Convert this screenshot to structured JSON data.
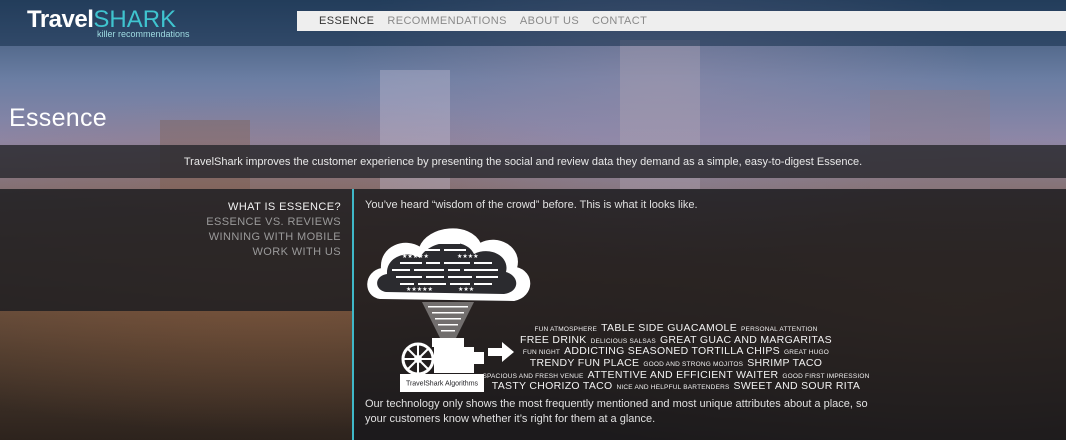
{
  "brand": {
    "name_part1": "Travel",
    "name_part2": "SHARK",
    "tagline": "killer recommendations"
  },
  "nav": {
    "items": [
      {
        "label": "ESSENCE",
        "active": true
      },
      {
        "label": "RECOMMENDATIONS",
        "active": false
      },
      {
        "label": "ABOUT US",
        "active": false
      },
      {
        "label": "CONTACT",
        "active": false
      }
    ]
  },
  "hero": {
    "title": "Essence",
    "intro": "TravelShark improves the customer experience by presenting the social and review data they demand as a simple, easy-to-digest Essence."
  },
  "sidebar": {
    "items": [
      {
        "label": "WHAT IS ESSENCE?",
        "active": true
      },
      {
        "label": "ESSENCE VS. REVIEWS",
        "active": false
      },
      {
        "label": "WINNING WITH MOBILE",
        "active": false
      },
      {
        "label": "WORK WITH US",
        "active": false
      }
    ]
  },
  "content": {
    "lead": "You’ve heard “wisdom of the crowd” before. This is what it looks like.",
    "machine_label": "TravelShark Algorithms",
    "outro": "Our technology only shows the most frequently mentioned and most unique attributes about a place, so your customers know whether it’s right for them at a glance.",
    "word_cloud": [
      [
        {
          "t": "FUN ATMOSPHERE",
          "s": "sm"
        },
        {
          "t": "TABLE SIDE GUACAMOLE",
          "s": "big"
        },
        {
          "t": "PERSONAL ATTENTION",
          "s": "sm"
        }
      ],
      [
        {
          "t": "FREE DRINK",
          "s": "big"
        },
        {
          "t": "DELICIOUS SALSAS",
          "s": "sm"
        },
        {
          "t": "GREAT GUAC AND MARGARITAS",
          "s": "big"
        }
      ],
      [
        {
          "t": "FUN NIGHT",
          "s": "sm"
        },
        {
          "t": "ADDICTING SEASONED TORTILLA CHIPS",
          "s": "big"
        },
        {
          "t": "GREAT HUGO",
          "s": "sm"
        }
      ],
      [
        {
          "t": "TRENDY FUN PLACE",
          "s": "big"
        },
        {
          "t": "GOOD AND STRONG MOJITOS",
          "s": "sm"
        },
        {
          "t": "SHRIMP TACO",
          "s": "big"
        }
      ],
      [
        {
          "t": "SPACIOUS AND FRESH VENUE",
          "s": "sm"
        },
        {
          "t": "ATTENTIVE AND EFFICIENT WAITER",
          "s": "big"
        },
        {
          "t": "GOOD FIRST IMPRESSION",
          "s": "sm"
        }
      ],
      [
        {
          "t": "TASTY CHORIZO TACO",
          "s": "big"
        },
        {
          "t": "NICE AND HELPFUL BARTENDERS",
          "s": "sm"
        },
        {
          "t": "SWEET AND SOUR RITA",
          "s": "big"
        }
      ]
    ]
  },
  "colors": {
    "accent": "#3fc4cf",
    "nav_bg": "#eeeeee",
    "panel_bg": "#1e1e22"
  }
}
